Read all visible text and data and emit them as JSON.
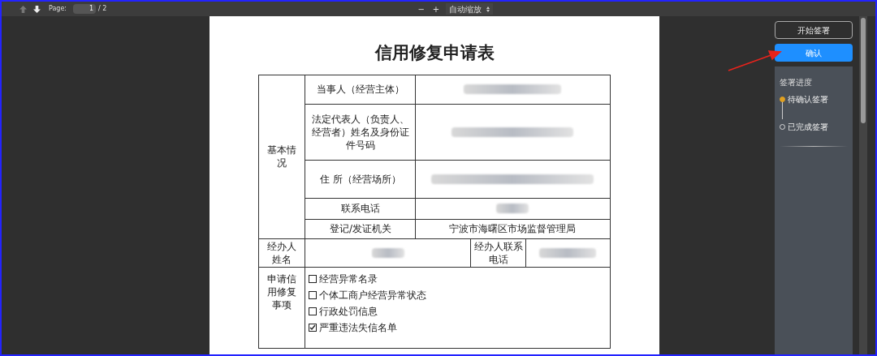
{
  "toolbar": {
    "page_label": "Page:",
    "page_value": "1",
    "page_total": "/ 2",
    "zoom_out": "−",
    "zoom_in": "+",
    "zoom_select": "自动缩放"
  },
  "document": {
    "title": "信用修复申请表",
    "basic_info": {
      "group_label": "基本情况",
      "rows": [
        {
          "label": "当事人（经营主体）",
          "redacted": true
        },
        {
          "label": "法定代表人（负责人、经营者）姓名及身份证件号码",
          "redacted": true
        },
        {
          "label": "住 所（经营场所）",
          "redacted": true
        },
        {
          "label": "联系电话",
          "redacted": true
        },
        {
          "label": "登记/发证机关",
          "redacted": false,
          "value": "宁波市海曙区市场监督管理局"
        }
      ]
    },
    "handler": {
      "name_label": "经办人姓名",
      "name_redacted": true,
      "phone_label": "经办人联系电话",
      "phone_redacted": true
    },
    "request": {
      "label": "申请信用修复事项",
      "options": [
        {
          "label": "经营异常名录",
          "checked": false
        },
        {
          "label": "个体工商户经营异常状态",
          "checked": false
        },
        {
          "label": "行政处罚信息",
          "checked": false
        },
        {
          "label": "严重违法失信名单",
          "checked": true
        }
      ]
    }
  },
  "sidebar": {
    "start_button": "开始签署",
    "confirm_button": "确认",
    "progress": {
      "title": "签署进度",
      "steps": [
        {
          "label": "待确认签署",
          "selected": true
        },
        {
          "label": "已完成签署",
          "selected": false
        }
      ]
    }
  }
}
